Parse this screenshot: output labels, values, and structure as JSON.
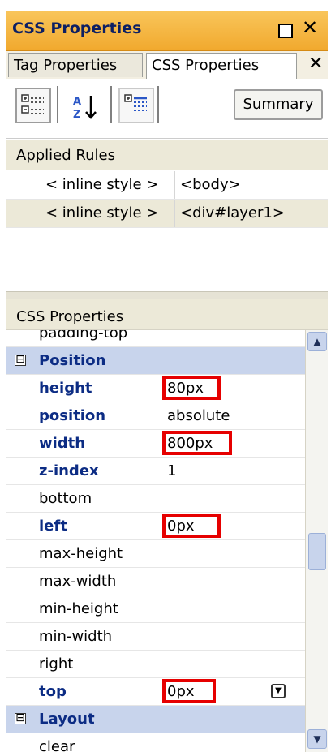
{
  "panel": {
    "title": "CSS Properties"
  },
  "tabs": [
    {
      "label": "Tag Properties"
    },
    {
      "label": "CSS Properties"
    }
  ],
  "toolbar": {
    "summary_label": "Summary",
    "category_view_icon": "category-view-icon",
    "sort_az_icon": "sort-az-icon",
    "set_properties_icon": "show-set-properties-icon"
  },
  "applied_rules": {
    "header": "Applied Rules",
    "rules": [
      {
        "selector": "< inline style >",
        "target": "<body>"
      },
      {
        "selector": "< inline style >",
        "target": "<div#layer1>",
        "selected": true
      }
    ]
  },
  "css_properties": {
    "header": "CSS Properties",
    "rows": [
      {
        "type": "prop",
        "name": "padding-top",
        "value": ""
      },
      {
        "type": "category",
        "name": "Position",
        "expander": "⊟"
      },
      {
        "type": "prop",
        "name": "height",
        "value": "80px",
        "set": true,
        "highlight": true
      },
      {
        "type": "prop",
        "name": "position",
        "value": "absolute",
        "set": true
      },
      {
        "type": "prop",
        "name": "width",
        "value": "800px",
        "set": true,
        "highlight": true
      },
      {
        "type": "prop",
        "name": "z-index",
        "value": "1",
        "set": true
      },
      {
        "type": "prop",
        "name": "bottom",
        "value": ""
      },
      {
        "type": "prop",
        "name": "left",
        "value": "0px",
        "set": true,
        "highlight": true
      },
      {
        "type": "prop",
        "name": "max-height",
        "value": ""
      },
      {
        "type": "prop",
        "name": "max-width",
        "value": ""
      },
      {
        "type": "prop",
        "name": "min-height",
        "value": ""
      },
      {
        "type": "prop",
        "name": "min-width",
        "value": ""
      },
      {
        "type": "prop",
        "name": "right",
        "value": ""
      },
      {
        "type": "prop",
        "name": "top",
        "value": "0px",
        "set": true,
        "highlight": true,
        "editing": true
      },
      {
        "type": "category",
        "name": "Layout",
        "expander": "⊟"
      },
      {
        "type": "prop",
        "name": "clear",
        "value": ""
      }
    ]
  },
  "colors": {
    "title_bar": "#f1a92e",
    "category_row": "#c8d4ec",
    "set_property_text": "#0c2c84",
    "highlight_box": "#e60000"
  }
}
